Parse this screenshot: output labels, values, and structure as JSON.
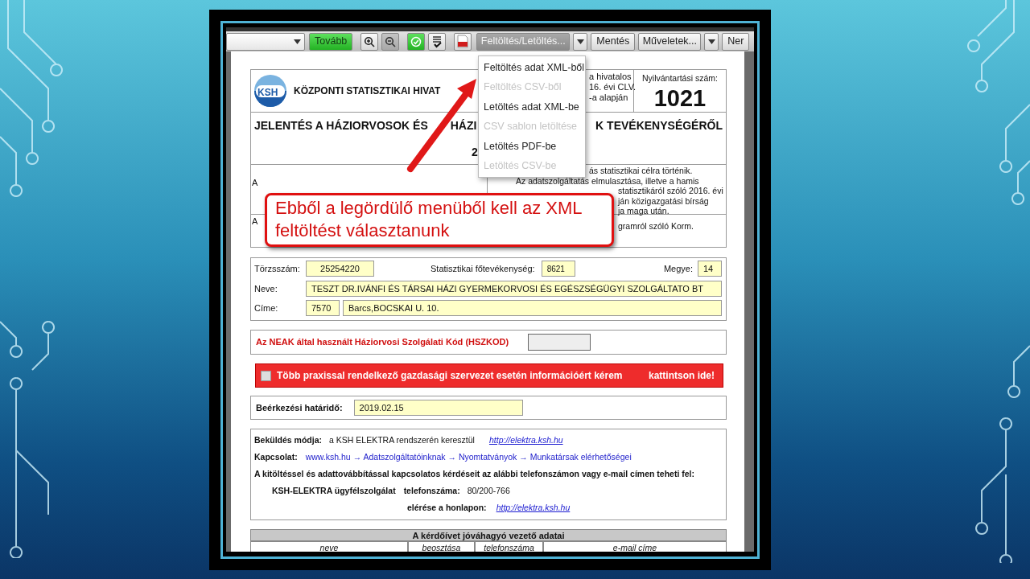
{
  "toolbar": [
    {
      "kind": "select"
    },
    {
      "kind": "button",
      "label": "Tovább",
      "highlighted": true
    },
    {
      "kind": "zoomin"
    },
    {
      "kind": "zoomout"
    },
    {
      "kind": "validate"
    },
    {
      "kind": "checklist"
    },
    {
      "kind": "pdf"
    },
    {
      "kind": "split",
      "label": "Feltöltés/Letöltés...",
      "expanded": true
    },
    {
      "kind": "button",
      "label": "Mentés",
      "highlighted": false
    },
    {
      "kind": "split",
      "label": "Műveletek...",
      "expanded": false
    },
    {
      "kind": "button",
      "label": "Ner",
      "highlighted": false
    }
  ],
  "menu": [
    {
      "label": "Feltöltés adat XML-ből",
      "disabled": false
    },
    {
      "label": "Feltöltés CSV-ből",
      "disabled": true
    },
    {
      "label": "Letöltés adat XML-be",
      "disabled": false
    },
    {
      "label": "CSV sablon letöltése",
      "disabled": true
    },
    {
      "label": "Letöltés PDF-be",
      "disabled": false
    },
    {
      "label": "Letöltés CSV-be",
      "disabled": true
    }
  ],
  "header": {
    "logo": "KSH",
    "organization": "KÖZPONTI STATISZTIKAI HIVAT",
    "legal_lines": [
      "a hivatalos",
      "16. évi CLV.",
      "-a  alapján"
    ],
    "registry_label": "Nyilvántartási szám:",
    "registry_number": "1021",
    "title_parts": [
      "JELENTÉS A HÁZIORVOSOK ÉS",
      "HÁZI",
      "K TEVÉKENYSÉGÉRŐL"
    ],
    "title_line_2": "2",
    "notice_rows": [
      {
        "left": "A",
        "lines": [
          "ás statisztikai célra történik.",
          "Az adatszolgáltatás elmulasztása, illetve a hamis",
          "statisztikáról szóló 2016. évi",
          "ján közigazgatási bírság",
          "ja maga után."
        ]
      },
      {
        "left": "A",
        "lines": [
          "gramról szóló Korm."
        ]
      }
    ]
  },
  "identity": {
    "registration": {
      "label": "Törzsszám:",
      "value": "25254220"
    },
    "activity": {
      "label": "Statisztikai főtevékenység:",
      "value": "8621"
    },
    "county": {
      "label": "Megye:",
      "value": "14"
    },
    "name": {
      "label": "Neve:",
      "value": "TESZT DR.IVÁNFI ÉS TÁRSAI HÁZI GYERMEKORVOSI ÉS EGÉSZSÉGÜGYI SZOLGÁLTATO BT"
    },
    "address": {
      "label": "Címe:",
      "postcode": "7570",
      "street": "Barcs,BOCSKAI U. 10."
    }
  },
  "hszkod": {
    "label": "Az NEAK által használt Háziorvosi Szolgálati Kód (HSZKOD)"
  },
  "info_bar": {
    "checked": false,
    "text": "Több praxissal rendelkező gazdasági szervezet esetén információért kérem",
    "link": "kattintson ide!"
  },
  "deadline": {
    "label": "Beérkezési határidő:",
    "value": "2019.02.15"
  },
  "contact": {
    "submission_label": "Beküldés módja:",
    "submission_text": "a KSH ELEKTRA rendszerén keresztül",
    "submission_link": "http://elektra.ksh.hu",
    "contact_label": "Kapcsolat:",
    "contact_path": "www.ksh.hu → Adatszolgáltatóinknak → Nyomtatványok → Munkatársak elérhetőségei",
    "help_text": "A kitöltéssel és adattovábbítással kapcsolatos kérdéseit az alábbi telefonszámon vagy e-mail címen teheti fel:",
    "service_name": "KSH-ELEKTRA ügyfélszolgálat",
    "phone_label": "telefonszáma:",
    "phone": "80/200-766",
    "web_label": "elérése a honlapon:",
    "web_link": "http://elektra.ksh.hu"
  },
  "approver_table": {
    "title": "A kérdőívet jóváhagyó vezető adatai",
    "columns": [
      "neve",
      "beosztása",
      "telefonszáma",
      "e-mail címe"
    ]
  },
  "callout": {
    "text": "Ebből a legördülő menüből kell az XML feltöltést választanunk"
  }
}
